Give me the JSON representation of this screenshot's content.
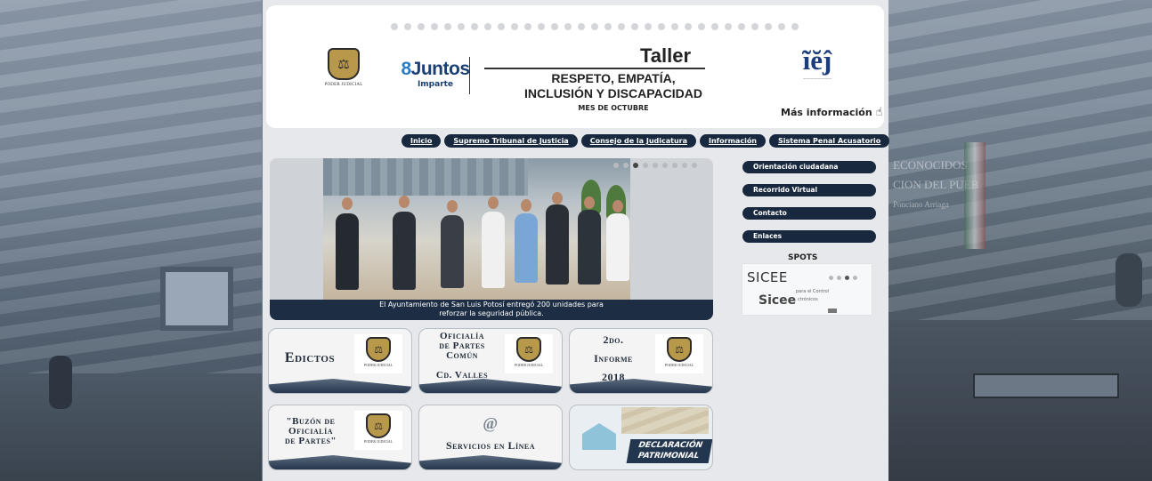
{
  "banner": {
    "org_logo_caption": "PODER JUDICIAL",
    "juntos_name": "Juntos",
    "juntos_sub": "Imparte",
    "title": "Taller",
    "subtitle_line1": "RESPETO, EMPATÍA,",
    "subtitle_line2": "INCLUSIÓN Y DISCAPACIDAD",
    "month": "MES DE OCTUBRE",
    "more_info": "Más información"
  },
  "nav": {
    "items": [
      "Inicio",
      "Supremo Tribunal de Justicia",
      "Consejo de la Judicatura",
      "Información",
      "Sistema Penal Acusatorio"
    ]
  },
  "slider": {
    "caption_line1": "El Ayuntamiento de San Luis Potosí entregó 200 unidades para",
    "caption_line2": "reforzar la seguridad pública.",
    "active_slide": 3,
    "slide_count": 9
  },
  "side_menu": {
    "items": [
      "Orientación ciudadana",
      "Recorrido Virtual",
      "Contacto",
      "Enlaces"
    ]
  },
  "spots": {
    "title": "SPOTS",
    "sicee_big": "SICEE",
    "sicee_brand": "Sicee",
    "sicee_desc": "para el Control",
    "sicee_desc2": "ctrónicos"
  },
  "tiles": {
    "edictos": "Edictos",
    "oficialia_valles_l1": "Oficialía",
    "oficialia_valles_l2": "de Partes",
    "oficialia_valles_l3": "Común",
    "oficialia_valles_l4": "Cd. Valles",
    "informe_l1": "2do.",
    "informe_l2": "Informe",
    "informe_l3": "2018",
    "buzon_l1": "\"Buzón de",
    "buzon_l2": "Oficialía",
    "buzon_l3": "de Partes\"",
    "servicios_icon": "@",
    "servicios": "Servicios en Línea",
    "declaracion_l1": "DECLARACIÓN",
    "declaracion_l2": "PATRIMONIAL",
    "mini_logo_caption": "PODER JUDICIAL"
  },
  "background": {
    "wall_text_1": "ECONOCIDOS",
    "wall_text_2": "CION DEL PUEB",
    "wall_text_3": "Ponciano Arriaga"
  }
}
